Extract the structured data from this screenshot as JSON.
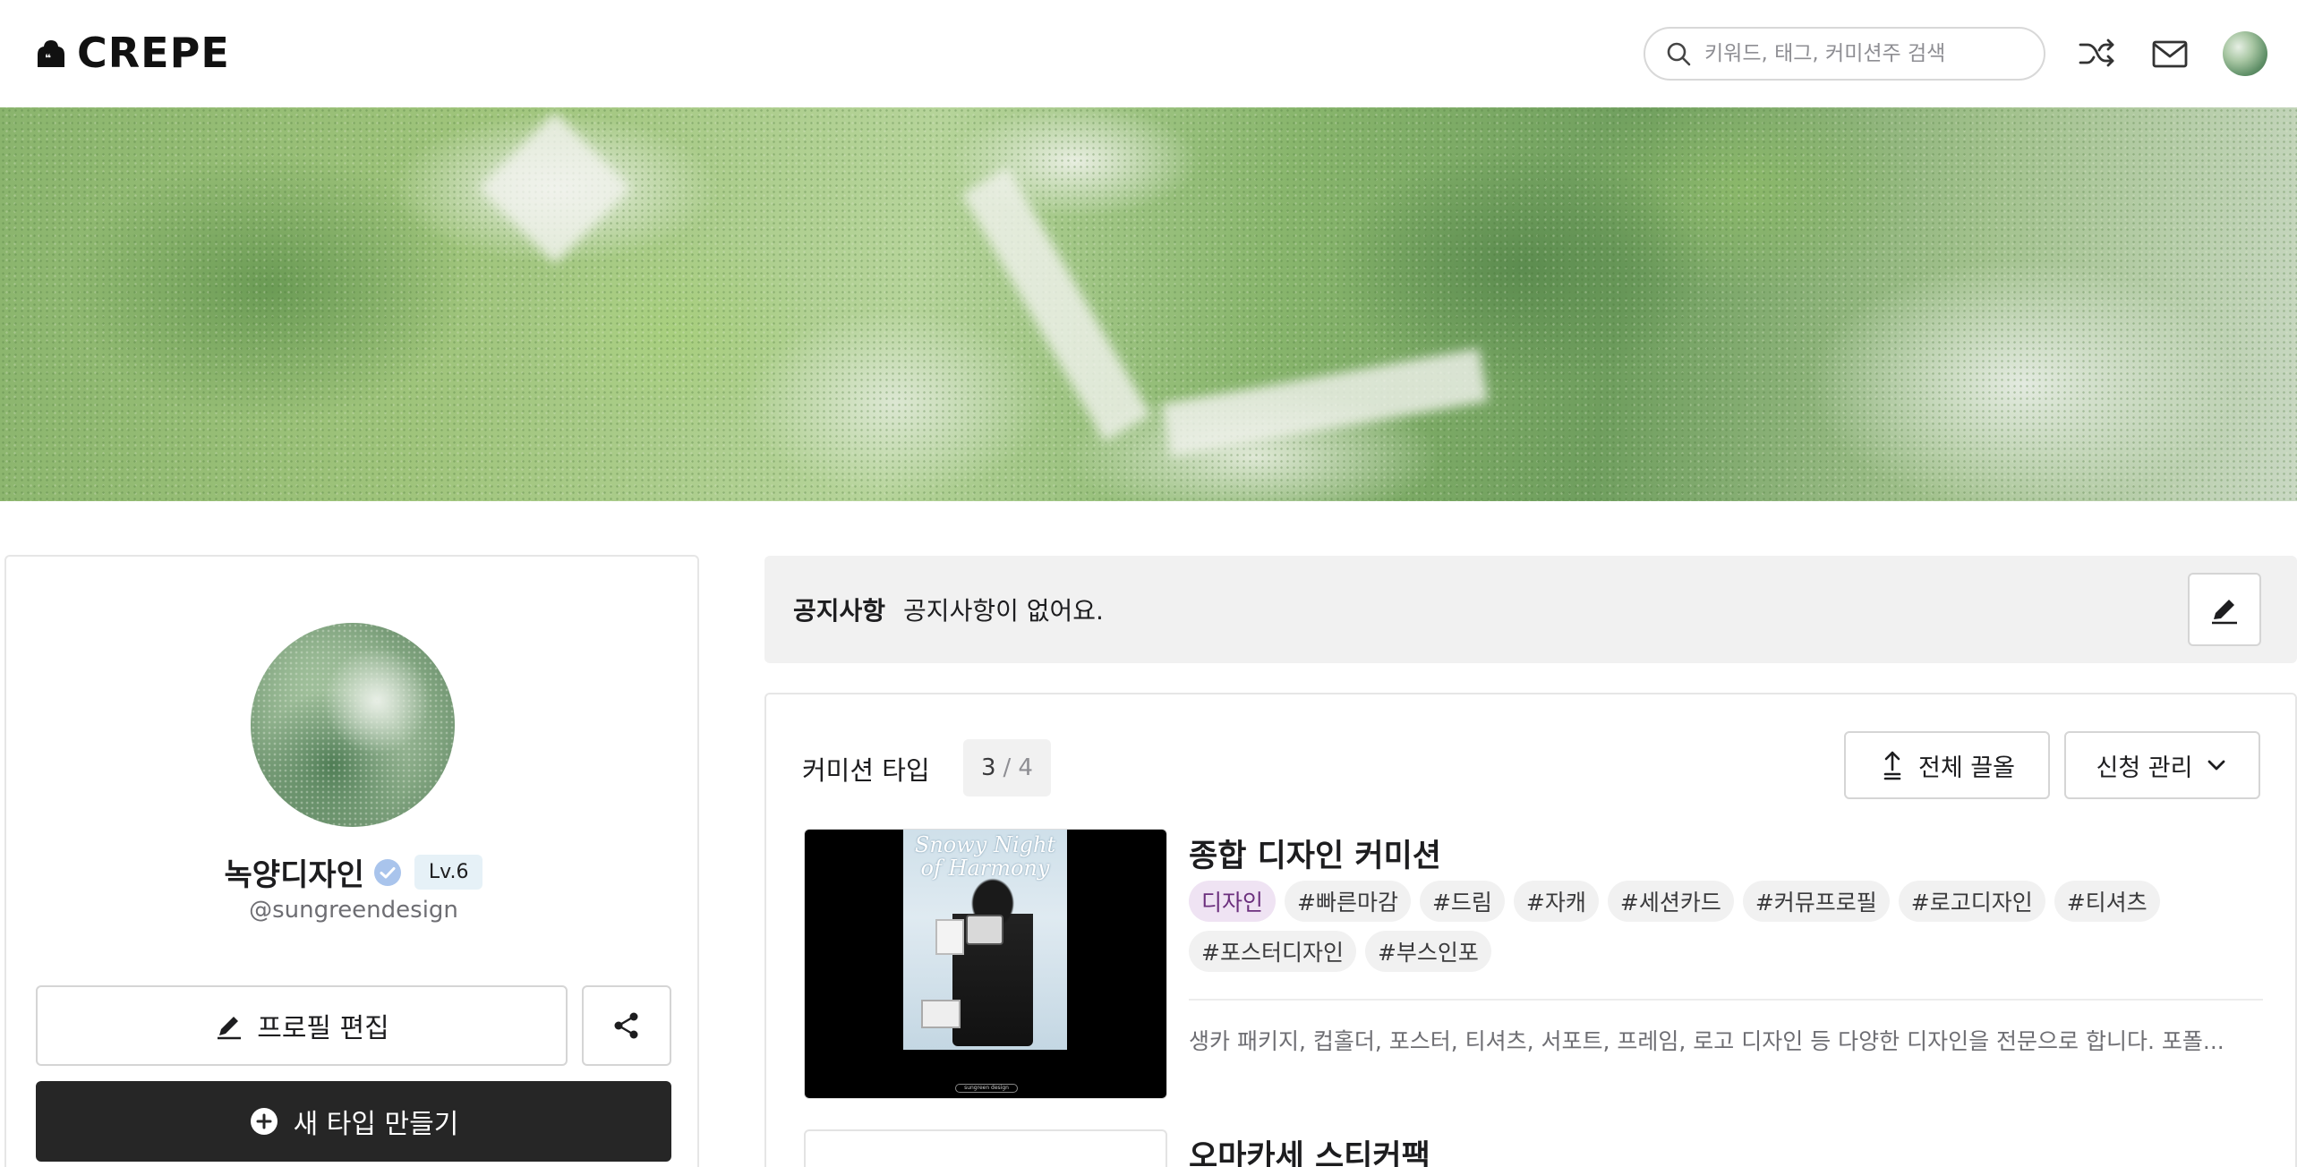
{
  "header": {
    "logo_text": "CREPE",
    "search_placeholder": "키워드, 태그, 커미션주 검색",
    "icons": [
      "search-icon",
      "shuffle-icon",
      "mail-icon",
      "avatar"
    ]
  },
  "profile": {
    "name": "녹양디자인",
    "level": "Lv.6",
    "handle": "@sungreendesign",
    "edit_button": "프로필 편집",
    "new_type_button": "새 타입 만들기"
  },
  "notice": {
    "label": "공지사항",
    "text": "공지사항이 없어요."
  },
  "commission": {
    "title": "커미션 타입",
    "count_current": "3",
    "count_separator": "/",
    "count_total": "4",
    "pull_up_button": "전체 끌올",
    "manage_button": "신청 관리",
    "items": [
      {
        "title": "종합 디자인 커미션",
        "category": "디자인",
        "tags": [
          "#빠른마감",
          "#드림",
          "#자캐",
          "#세션카드",
          "#커뮤프로필",
          "#로고디자인",
          "#티셔츠",
          "#포스터디자인",
          "#부스인포"
        ],
        "description": "생카 패키지, 컵홀더, 포스터, 티셔츠, 서포트, 프레임, 로고 디자인 등 다양한 디자인을 전문으로 합니다. 포폴...",
        "thumbnail_title": "Snowy Night of Harmony",
        "thumbnail_caption": "sungreen design"
      },
      {
        "title": "오마카세 스티커팩"
      }
    ]
  },
  "colors": {
    "primary_dark": "#262626",
    "category_tag_bg": "#efe3f3",
    "category_tag_text": "#6b2f7d",
    "level_badge_bg": "#e6f1f7",
    "verified_blue": "#a9c4ec",
    "notice_bg": "#f1f1f1"
  }
}
